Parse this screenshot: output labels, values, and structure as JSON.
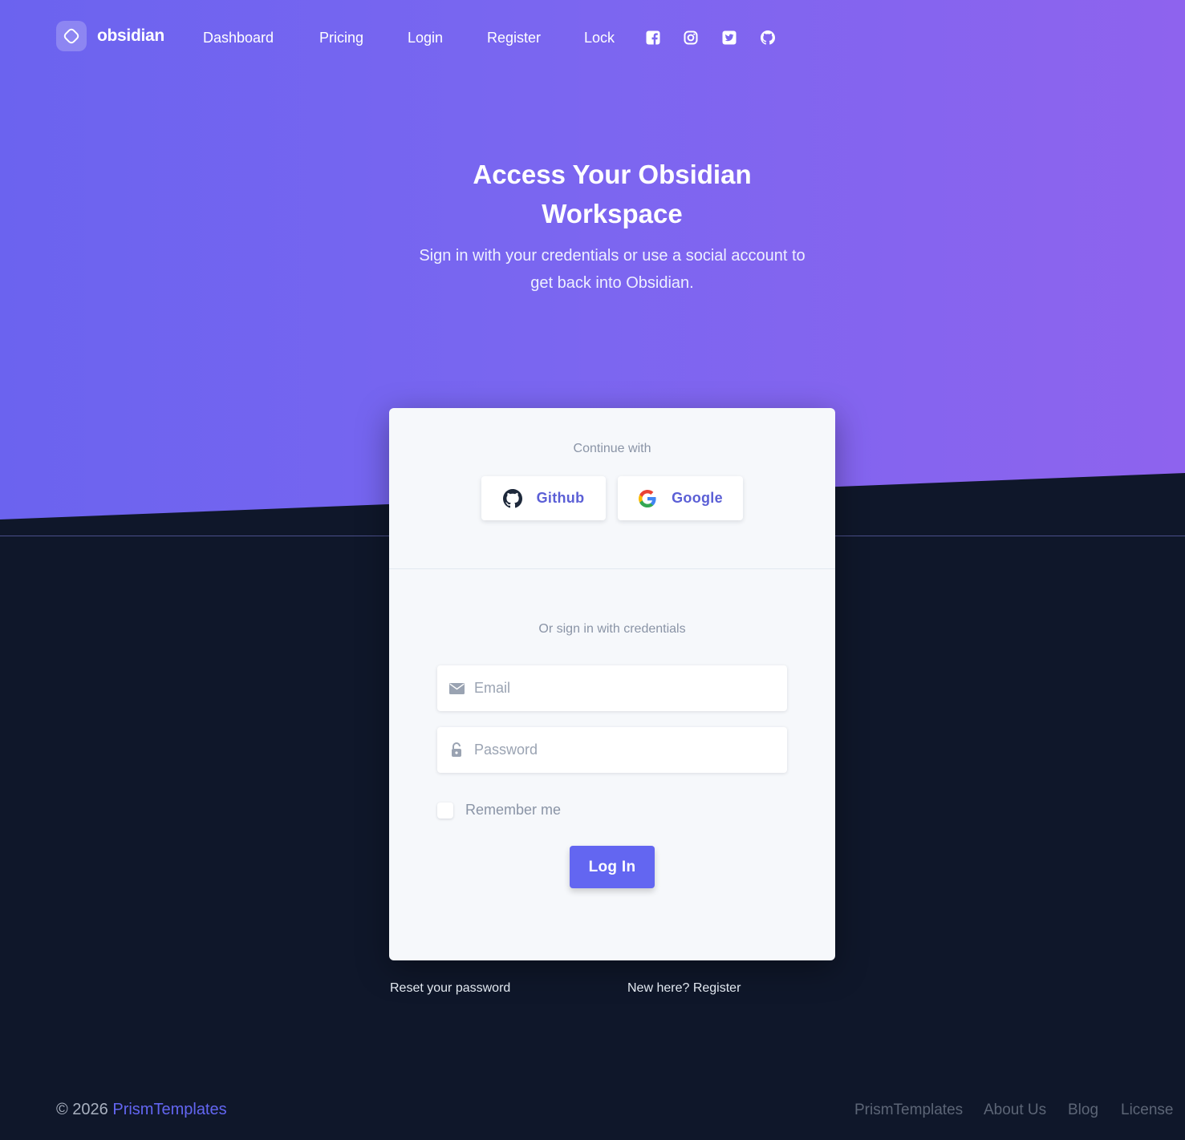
{
  "navbar": {
    "brand": "obsidian",
    "links": [
      "Dashboard",
      "Pricing",
      "Login",
      "Register",
      "Lock"
    ],
    "social_icons": [
      "facebook-icon",
      "instagram-icon",
      "twitter-icon",
      "github-icon"
    ]
  },
  "hero": {
    "title": "Access Your Obsidian Workspace",
    "subtitle": "Sign in with your credentials or use a social account to get back into Obsidian."
  },
  "card": {
    "continue_with": "Continue with",
    "github_label": "Github",
    "google_label": "Google",
    "credentials_label": "Or sign in with credentials",
    "email_placeholder": "Email",
    "password_placeholder": "Password",
    "remember_label": "Remember me",
    "login_label": "Log In"
  },
  "below_card": {
    "reset": "Reset your password",
    "register": "New here? Register"
  },
  "footer": {
    "copyright": "© 2026",
    "brand": "PrismTemplates",
    "links": [
      "PrismTemplates",
      "About Us",
      "Blog",
      "License"
    ]
  },
  "colors": {
    "accent": "#6366f1",
    "hero_start": "#6b63ef",
    "hero_end": "#8e63ee",
    "background": "#0f172a"
  }
}
